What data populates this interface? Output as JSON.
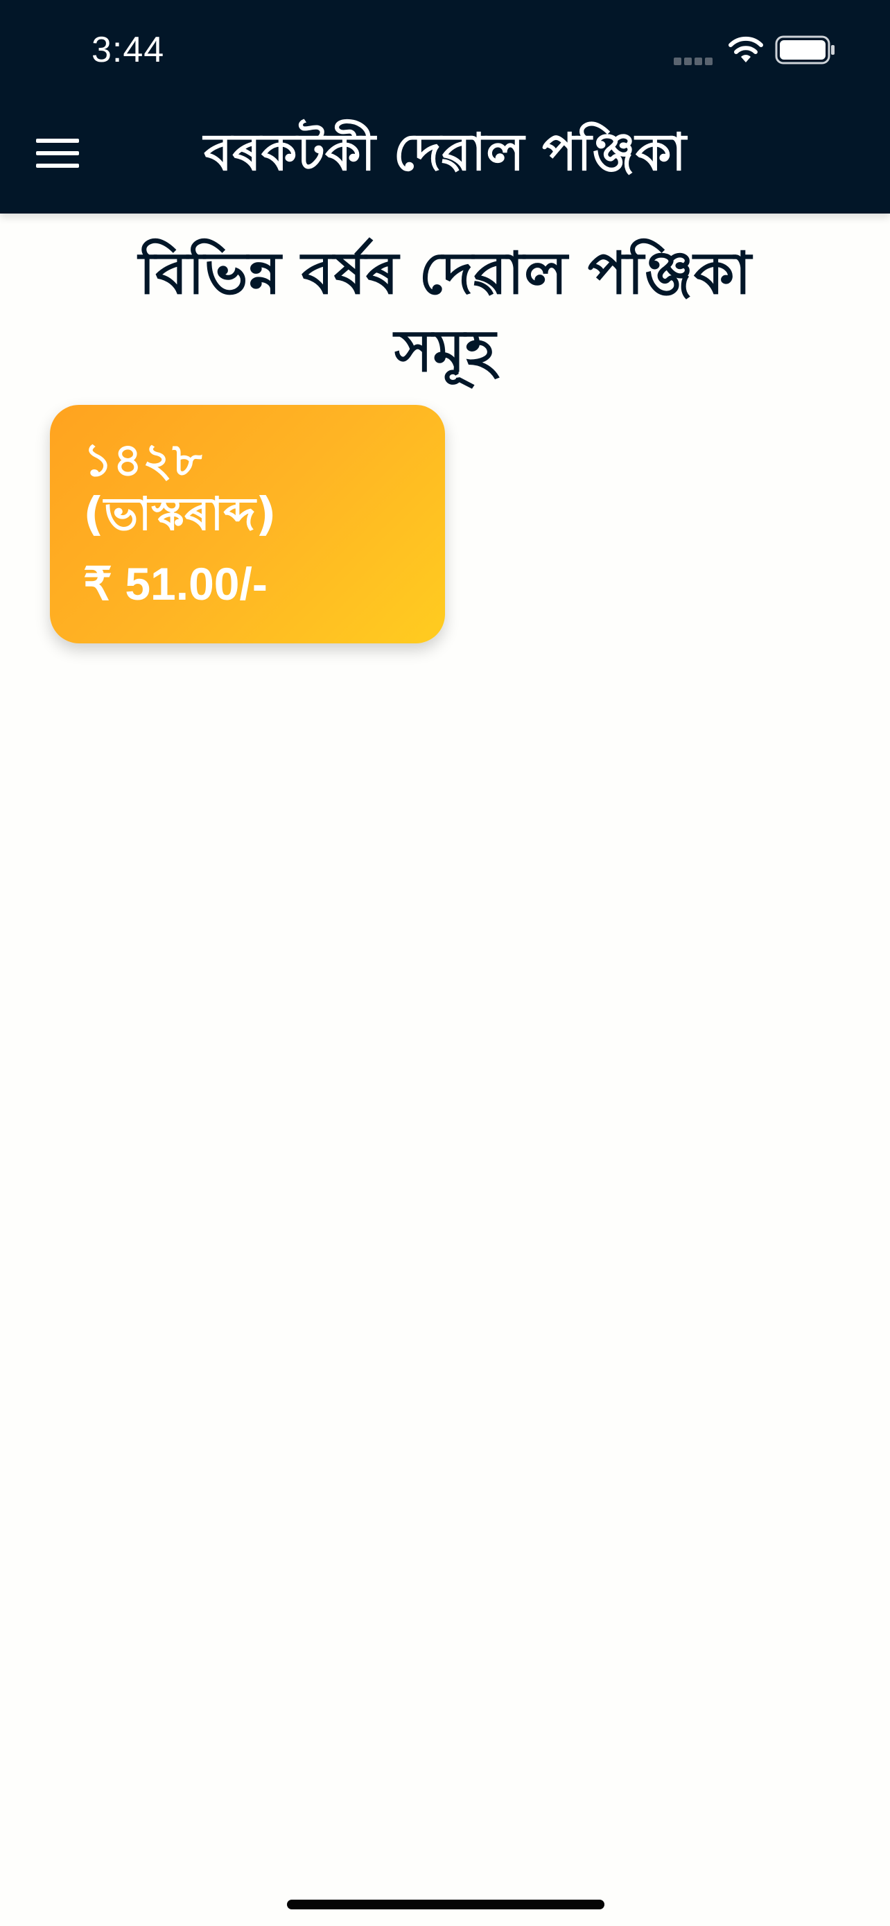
{
  "status_bar": {
    "time": "3:44"
  },
  "header": {
    "title": "বৰকটকী দেৱাল পঞ্জিকা",
    "menu_icon": "hamburger-menu-icon",
    "background_color": "#021628"
  },
  "main": {
    "heading": "বিভিন্ন বৰ্ষৰ দেৱাল পঞ্জিকা সমূহ",
    "cards": [
      {
        "year": "১৪২৮",
        "era": "(ভাস্কৰাব্দ)",
        "price": "₹ 51.00/-",
        "gradient_start": "#ffa31f",
        "gradient_end": "#ffcc20"
      }
    ]
  }
}
